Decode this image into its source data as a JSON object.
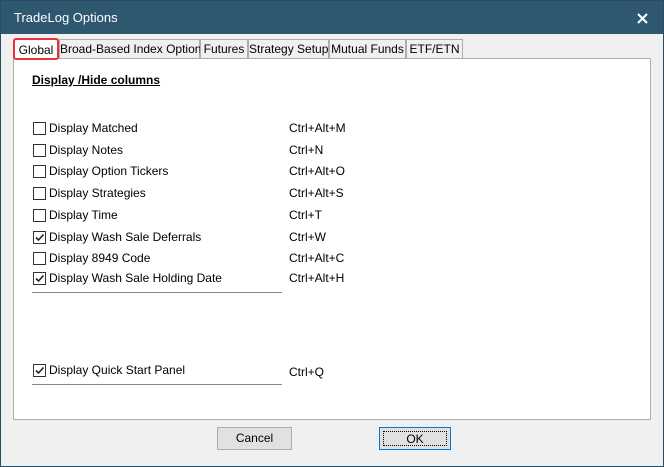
{
  "window": {
    "title": "TradeLog Options",
    "close_icon": "close-icon"
  },
  "tabs": [
    {
      "label": "Global",
      "active": true
    },
    {
      "label": "Broad-Based Index Options",
      "active": false
    },
    {
      "label": "Futures",
      "active": false
    },
    {
      "label": "Strategy Setup",
      "active": false
    },
    {
      "label": "Mutual Funds",
      "active": false
    },
    {
      "label": "ETF/ETN",
      "active": false
    }
  ],
  "global": {
    "section_title": "Display /Hide columns",
    "options": [
      {
        "label": "Display Matched",
        "shortcut": "Ctrl+Alt+M",
        "checked": false
      },
      {
        "label": "Display Notes",
        "shortcut": "Ctrl+N",
        "checked": false
      },
      {
        "label": "Display Option Tickers",
        "shortcut": "Ctrl+Alt+O",
        "checked": false
      },
      {
        "label": "Display Strategies",
        "shortcut": "Ctrl+Alt+S",
        "checked": false
      },
      {
        "label": "Display Time",
        "shortcut": "Ctrl+T",
        "checked": false
      },
      {
        "label": "Display Wash Sale Deferrals",
        "shortcut": "Ctrl+W",
        "checked": true
      },
      {
        "label": "Display 8949 Code",
        "shortcut": "Ctrl+Alt+C",
        "checked": false
      },
      {
        "label": "Display Wash Sale Holding Date",
        "shortcut": "Ctrl+Alt+H",
        "checked": true
      }
    ],
    "quick_start": {
      "label": "Display Quick Start Panel",
      "shortcut": "Ctrl+Q",
      "checked": true
    }
  },
  "buttons": {
    "cancel_label": "Cancel",
    "ok_label": "OK"
  },
  "colors": {
    "titlebar": "#2e5770",
    "active_tab_highlight": "#e8313a"
  }
}
